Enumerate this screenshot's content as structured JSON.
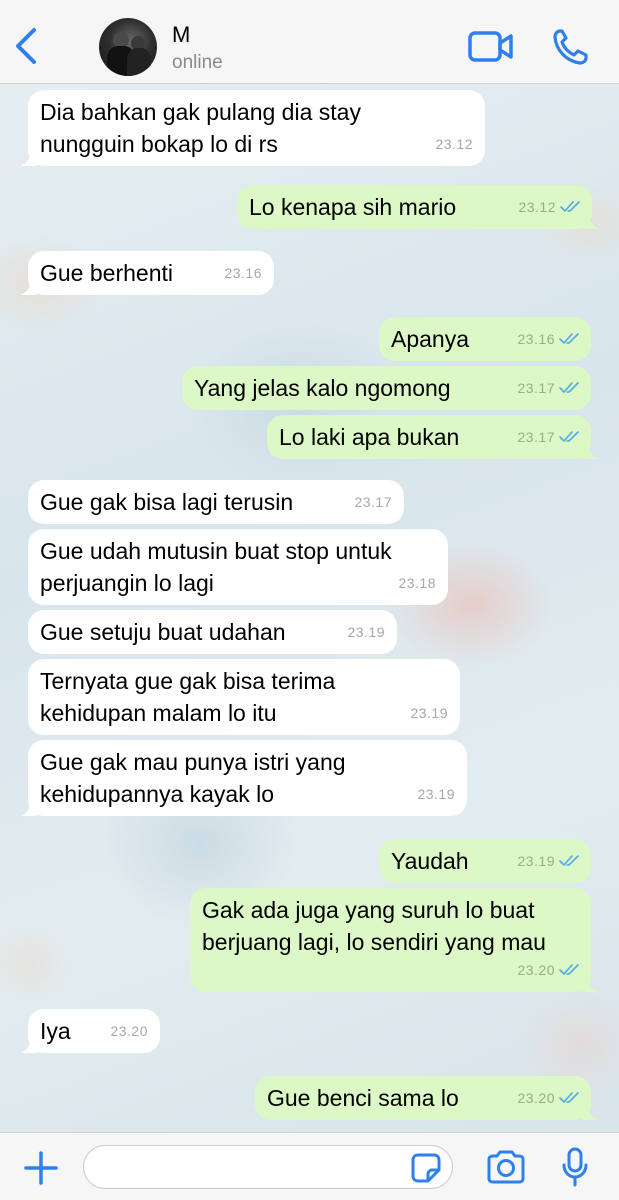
{
  "header": {
    "contact_name": "M",
    "status": "online",
    "icons": [
      "chevron-left-icon",
      "video-camera-icon",
      "phone-icon"
    ],
    "accent_color": "#2f80ed"
  },
  "messages": [
    {
      "direction": "in",
      "text": "Dia bahkan gak pulang dia stay\nnungguin bokap lo di rs",
      "time": "23.12"
    },
    {
      "direction": "out",
      "text": "Lo kenapa sih mario",
      "time": "23.12",
      "status": "read"
    },
    {
      "direction": "in",
      "text": "Gue berhenti",
      "time": "23.16"
    },
    {
      "direction": "out",
      "text": "Apanya",
      "time": "23.16",
      "status": "read"
    },
    {
      "direction": "out",
      "text": "Yang jelas kalo ngomong",
      "time": "23.17",
      "status": "read"
    },
    {
      "direction": "out",
      "text": "Lo laki apa bukan",
      "time": "23.17",
      "status": "read"
    },
    {
      "direction": "in",
      "text": "Gue gak bisa lagi terusin",
      "time": "23.17"
    },
    {
      "direction": "in",
      "text": "Gue udah mutusin buat stop untuk\nperjuangin lo lagi",
      "time": "23.18"
    },
    {
      "direction": "in",
      "text": "Gue setuju buat udahan",
      "time": "23.19"
    },
    {
      "direction": "in",
      "text": "Ternyata gue gak bisa terima\nkehidupan malam lo itu",
      "time": "23.19"
    },
    {
      "direction": "in",
      "text": "Gue gak mau punya istri yang\nkehidupannya kayak lo",
      "time": "23.19"
    },
    {
      "direction": "out",
      "text": "Yaudah",
      "time": "23.19",
      "status": "read"
    },
    {
      "direction": "out",
      "text": "Gak ada juga yang suruh lo buat\nberjuang lagi, lo sendiri yang mau",
      "time": "23.20",
      "status": "read"
    },
    {
      "direction": "in",
      "text": "Iya",
      "time": "23.20"
    },
    {
      "direction": "out",
      "text": "Gue benci sama lo",
      "time": "23.20",
      "status": "read"
    }
  ],
  "input": {
    "value": "",
    "placeholder": "",
    "icons": [
      "plus-icon",
      "sticker-icon",
      "camera-icon",
      "microphone-icon"
    ]
  },
  "colors": {
    "incoming_bubble": "#ffffff",
    "outgoing_bubble": "#dcf8c6",
    "read_tick": "#4fa8e8"
  }
}
